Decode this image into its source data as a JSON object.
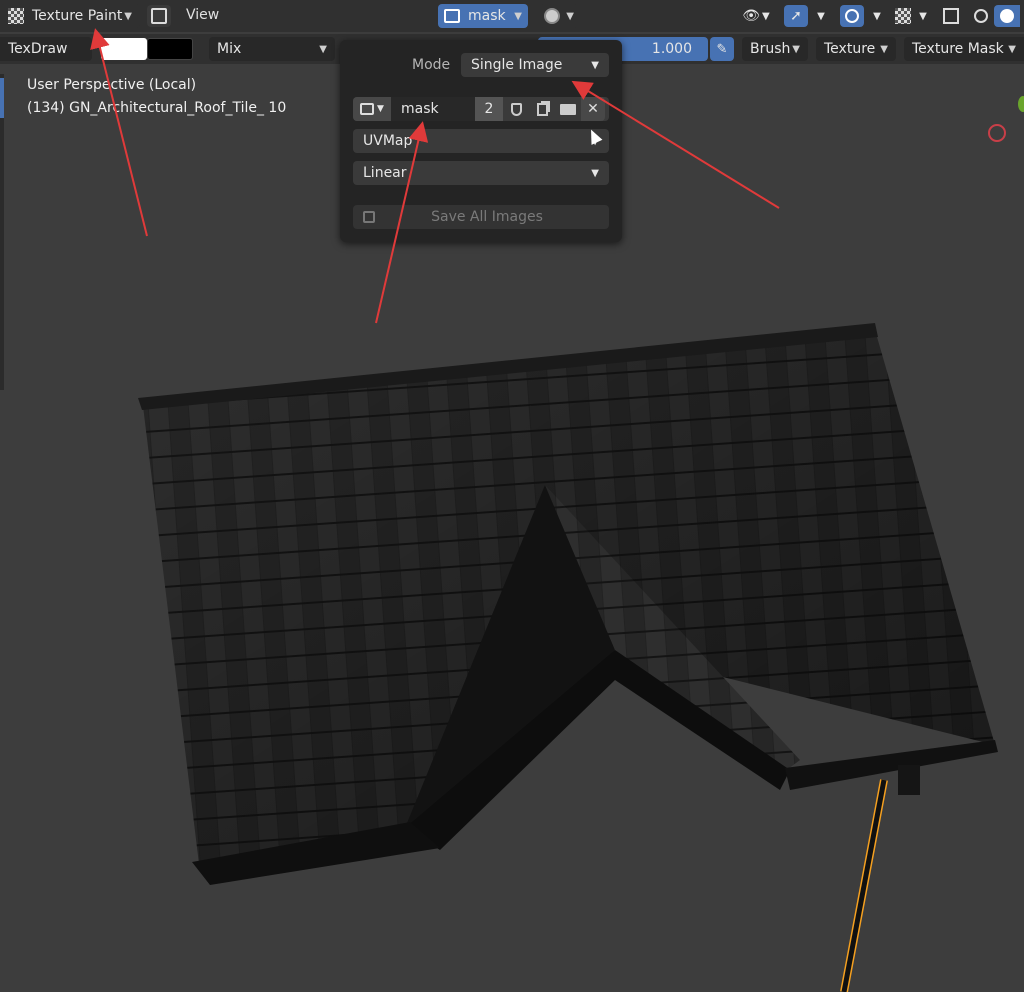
{
  "header": {
    "mode_label": "Texture Paint",
    "view_menu": "View",
    "image_selector_label": "mask",
    "mode_icon": "checker-icon"
  },
  "toolbar": {
    "brush_name": "TexDraw",
    "blend_mode": "Mix",
    "strength_value": "1.000",
    "brush_menu": "Brush",
    "texture_menu": "Texture",
    "texture_mask_menu": "Texture Mask",
    "primary_color": "#ffffff",
    "secondary_color": "#000000"
  },
  "popup": {
    "mode_label": "Mode",
    "mode_value": "Single Image",
    "image_name": "mask",
    "image_users": "2",
    "uv_map": "UVMap",
    "interpolation": "Linear",
    "save_all_label": "Save All Images"
  },
  "viewport": {
    "perspective_text": "User Perspective (Local)",
    "object_text": "(134) GN_Architectural_Roof_Tile_ 10"
  },
  "colors": {
    "accent_blue": "#4772b3",
    "annotation_red": "#e03a3a",
    "background": "#3d3d3d"
  }
}
